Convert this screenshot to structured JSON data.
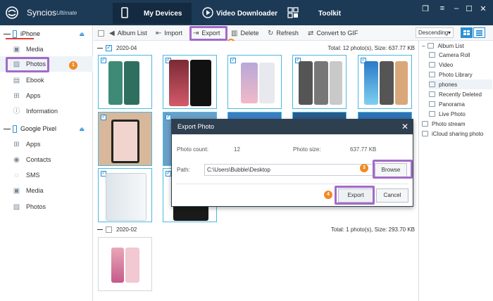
{
  "app": {
    "name": "Syncios",
    "edition": "Ultimate"
  },
  "nav": {
    "tabs": [
      {
        "label": "My Devices",
        "active": true
      },
      {
        "label": "Video Downloader",
        "active": false
      },
      {
        "label": "Toolkit",
        "active": false
      }
    ]
  },
  "window_controls": [
    "❐",
    "≡",
    "–",
    "☐",
    "✕"
  ],
  "sidebar": {
    "device1": {
      "name": "iPhone",
      "items": [
        "Media",
        "Photos",
        "Ebook",
        "Apps",
        "Information"
      ]
    },
    "device2": {
      "name": "Google Pixel",
      "items": [
        "Apps",
        "Contacts",
        "SMS",
        "Media",
        "Photos"
      ]
    }
  },
  "toolbar": {
    "album_list": "Album List",
    "import": "Import",
    "export": "Export",
    "delete": "Delete",
    "refresh": "Refresh",
    "convert": "Convert to GIF",
    "sort": "Descending"
  },
  "groups": [
    {
      "date": "2020-04",
      "total": "Total: 12 photo(s), Size: 637.77 KB"
    },
    {
      "date": "2020-02",
      "total": "Total: 1 photo(s), Size: 293.70 KB"
    }
  ],
  "albums": {
    "root": "Album List",
    "items": [
      "Camera Roll",
      "Video",
      "Photo Library",
      "phones",
      "Recently Deleted",
      "Panorama",
      "Live Photo"
    ],
    "extra": [
      "Photo stream",
      "iCloud sharing photo"
    ]
  },
  "dialog": {
    "title": "Export Photo",
    "count_label": "Photo count:",
    "count_value": "12",
    "size_label": "Photo size:",
    "size_value": "637.77 KB",
    "path_label": "Path:",
    "path_value": "C:\\Users\\Bubble\\Desktop",
    "browse": "Browse",
    "export": "Export",
    "cancel": "Cancel"
  },
  "steps": [
    "1",
    "2",
    "3",
    "4"
  ],
  "colors": {
    "accent": "#2a8fd4",
    "highlight": "#a36ac8",
    "badge": "#f08a24",
    "titlebar": "#1c3a56"
  }
}
